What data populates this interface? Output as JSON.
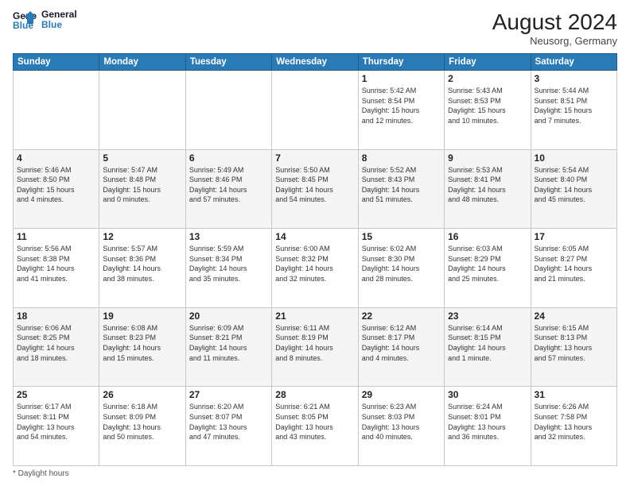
{
  "header": {
    "logo_line1": "General",
    "logo_line2": "Blue",
    "month_year": "August 2024",
    "location": "Neusorg, Germany"
  },
  "footer": {
    "note": "Daylight hours"
  },
  "weekdays": [
    "Sunday",
    "Monday",
    "Tuesday",
    "Wednesday",
    "Thursday",
    "Friday",
    "Saturday"
  ],
  "weeks": [
    [
      {
        "day": "",
        "info": ""
      },
      {
        "day": "",
        "info": ""
      },
      {
        "day": "",
        "info": ""
      },
      {
        "day": "",
        "info": ""
      },
      {
        "day": "1",
        "info": "Sunrise: 5:42 AM\nSunset: 8:54 PM\nDaylight: 15 hours\nand 12 minutes."
      },
      {
        "day": "2",
        "info": "Sunrise: 5:43 AM\nSunset: 8:53 PM\nDaylight: 15 hours\nand 10 minutes."
      },
      {
        "day": "3",
        "info": "Sunrise: 5:44 AM\nSunset: 8:51 PM\nDaylight: 15 hours\nand 7 minutes."
      }
    ],
    [
      {
        "day": "4",
        "info": "Sunrise: 5:46 AM\nSunset: 8:50 PM\nDaylight: 15 hours\nand 4 minutes."
      },
      {
        "day": "5",
        "info": "Sunrise: 5:47 AM\nSunset: 8:48 PM\nDaylight: 15 hours\nand 0 minutes."
      },
      {
        "day": "6",
        "info": "Sunrise: 5:49 AM\nSunset: 8:46 PM\nDaylight: 14 hours\nand 57 minutes."
      },
      {
        "day": "7",
        "info": "Sunrise: 5:50 AM\nSunset: 8:45 PM\nDaylight: 14 hours\nand 54 minutes."
      },
      {
        "day": "8",
        "info": "Sunrise: 5:52 AM\nSunset: 8:43 PM\nDaylight: 14 hours\nand 51 minutes."
      },
      {
        "day": "9",
        "info": "Sunrise: 5:53 AM\nSunset: 8:41 PM\nDaylight: 14 hours\nand 48 minutes."
      },
      {
        "day": "10",
        "info": "Sunrise: 5:54 AM\nSunset: 8:40 PM\nDaylight: 14 hours\nand 45 minutes."
      }
    ],
    [
      {
        "day": "11",
        "info": "Sunrise: 5:56 AM\nSunset: 8:38 PM\nDaylight: 14 hours\nand 41 minutes."
      },
      {
        "day": "12",
        "info": "Sunrise: 5:57 AM\nSunset: 8:36 PM\nDaylight: 14 hours\nand 38 minutes."
      },
      {
        "day": "13",
        "info": "Sunrise: 5:59 AM\nSunset: 8:34 PM\nDaylight: 14 hours\nand 35 minutes."
      },
      {
        "day": "14",
        "info": "Sunrise: 6:00 AM\nSunset: 8:32 PM\nDaylight: 14 hours\nand 32 minutes."
      },
      {
        "day": "15",
        "info": "Sunrise: 6:02 AM\nSunset: 8:30 PM\nDaylight: 14 hours\nand 28 minutes."
      },
      {
        "day": "16",
        "info": "Sunrise: 6:03 AM\nSunset: 8:29 PM\nDaylight: 14 hours\nand 25 minutes."
      },
      {
        "day": "17",
        "info": "Sunrise: 6:05 AM\nSunset: 8:27 PM\nDaylight: 14 hours\nand 21 minutes."
      }
    ],
    [
      {
        "day": "18",
        "info": "Sunrise: 6:06 AM\nSunset: 8:25 PM\nDaylight: 14 hours\nand 18 minutes."
      },
      {
        "day": "19",
        "info": "Sunrise: 6:08 AM\nSunset: 8:23 PM\nDaylight: 14 hours\nand 15 minutes."
      },
      {
        "day": "20",
        "info": "Sunrise: 6:09 AM\nSunset: 8:21 PM\nDaylight: 14 hours\nand 11 minutes."
      },
      {
        "day": "21",
        "info": "Sunrise: 6:11 AM\nSunset: 8:19 PM\nDaylight: 14 hours\nand 8 minutes."
      },
      {
        "day": "22",
        "info": "Sunrise: 6:12 AM\nSunset: 8:17 PM\nDaylight: 14 hours\nand 4 minutes."
      },
      {
        "day": "23",
        "info": "Sunrise: 6:14 AM\nSunset: 8:15 PM\nDaylight: 14 hours\nand 1 minute."
      },
      {
        "day": "24",
        "info": "Sunrise: 6:15 AM\nSunset: 8:13 PM\nDaylight: 13 hours\nand 57 minutes."
      }
    ],
    [
      {
        "day": "25",
        "info": "Sunrise: 6:17 AM\nSunset: 8:11 PM\nDaylight: 13 hours\nand 54 minutes."
      },
      {
        "day": "26",
        "info": "Sunrise: 6:18 AM\nSunset: 8:09 PM\nDaylight: 13 hours\nand 50 minutes."
      },
      {
        "day": "27",
        "info": "Sunrise: 6:20 AM\nSunset: 8:07 PM\nDaylight: 13 hours\nand 47 minutes."
      },
      {
        "day": "28",
        "info": "Sunrise: 6:21 AM\nSunset: 8:05 PM\nDaylight: 13 hours\nand 43 minutes."
      },
      {
        "day": "29",
        "info": "Sunrise: 6:23 AM\nSunset: 8:03 PM\nDaylight: 13 hours\nand 40 minutes."
      },
      {
        "day": "30",
        "info": "Sunrise: 6:24 AM\nSunset: 8:01 PM\nDaylight: 13 hours\nand 36 minutes."
      },
      {
        "day": "31",
        "info": "Sunrise: 6:26 AM\nSunset: 7:58 PM\nDaylight: 13 hours\nand 32 minutes."
      }
    ]
  ]
}
